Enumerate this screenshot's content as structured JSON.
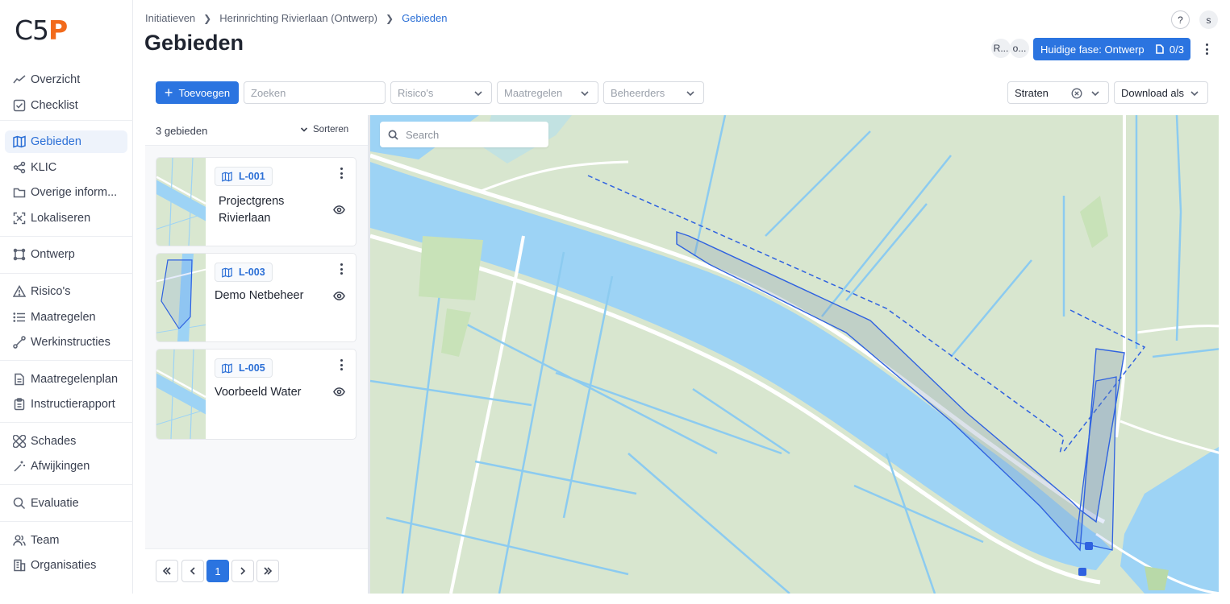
{
  "brand": {
    "logo_a": "C5",
    "logo_b": "P"
  },
  "sidebar": {
    "items": [
      {
        "label": "Overzicht",
        "icon": "trend-line-icon"
      },
      {
        "label": "Checklist",
        "icon": "check-square-icon"
      },
      {
        "label": "Gebieden",
        "icon": "map-icon",
        "active": true
      },
      {
        "label": "KLIC",
        "icon": "share-nodes-icon"
      },
      {
        "label": "Overige inform...",
        "icon": "folder-icon"
      },
      {
        "label": "Lokaliseren",
        "icon": "locate-icon"
      },
      {
        "label": "Ontwerp",
        "icon": "frame-icon"
      },
      {
        "label": "Risico's",
        "icon": "warning-icon"
      },
      {
        "label": "Maatregelen",
        "icon": "list-icon"
      },
      {
        "label": "Werkinstructies",
        "icon": "route-icon"
      },
      {
        "label": "Maatregelenplan",
        "icon": "document-icon"
      },
      {
        "label": "Instructierapport",
        "icon": "clipboard-icon"
      },
      {
        "label": "Schades",
        "icon": "bandage-icon"
      },
      {
        "label": "Afwijkingen",
        "icon": "wand-icon"
      },
      {
        "label": "Evaluatie",
        "icon": "search-icon"
      },
      {
        "label": "Team",
        "icon": "users-icon"
      },
      {
        "label": "Organisaties",
        "icon": "building-icon"
      }
    ]
  },
  "header": {
    "breadcrumb": [
      "Initiatieven",
      "Herinrichting Rivierlaan (Ontwerp)",
      "Gebieden"
    ],
    "title": "Gebieden",
    "help": "?",
    "user_initial": "s",
    "avatars": [
      "R...",
      "o..."
    ],
    "phase_label": "Huidige fase: Ontwerp",
    "phase_count": "0/3"
  },
  "toolbar": {
    "add_label": "Toevoegen",
    "search_placeholder": "Zoeken",
    "filters": [
      "Risico's",
      "Maatregelen",
      "Beheerders"
    ],
    "layer_value": "Straten",
    "download_label": "Download als"
  },
  "list": {
    "count_label": "3 gebieden",
    "sort_label": "Sorteren",
    "items": [
      {
        "code": "L-001",
        "title": "Projectgrens Rivierlaan"
      },
      {
        "code": "L-003",
        "title": "Demo Netbeheer"
      },
      {
        "code": "L-005",
        "title": "Voorbeeld Water"
      }
    ],
    "pagination": {
      "current": "1"
    }
  },
  "map": {
    "search_placeholder": "Search",
    "colors": {
      "land": "#d8e6cf",
      "water": "#9dd3f5",
      "road": "#ffffff",
      "polygon": "#2f62e0"
    }
  }
}
